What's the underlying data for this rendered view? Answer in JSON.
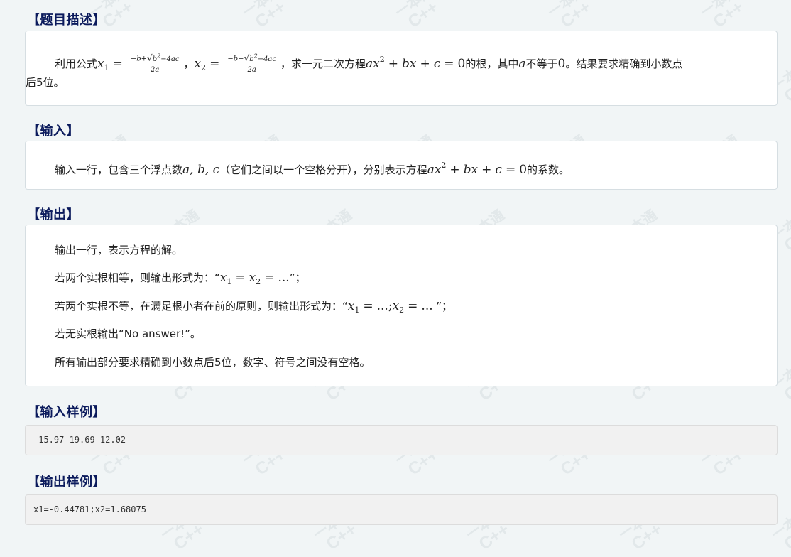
{
  "watermark": {
    "text": "C++",
    "glyph": "一本通",
    "color": "#e2e8ea"
  },
  "sections": {
    "description": {
      "heading": "【题目描述】",
      "p1": {
        "t1": "利用公式",
        "x1": "x",
        "s1": "1",
        "eq1": "=",
        "frac1_num_a": "−b+",
        "frac1_num_root": "b",
        "frac1_num_sq": "2",
        "frac1_num_b": "−4ac",
        "frac1_den": "2a",
        "sep": "，",
        "x2": "x",
        "s2": "2",
        "eq2": "=",
        "frac2_num_a": "−b−",
        "frac2_num_root": "b",
        "frac2_num_sq": "2",
        "frac2_num_b": "−4ac",
        "frac2_den": "2a",
        "t2": "，求一元二次方程",
        "eq_a": "ax",
        "eq_sq": "2",
        "eq_plus1": "+",
        "eq_b": "bx",
        "eq_plus2": "+",
        "eq_c": "c",
        "eq_eq": "=",
        "eq_zero": "0",
        "t3": "的根，其中",
        "var_a": "a",
        "t4": "不等于",
        "zero": "0",
        "t5": "。结果要求精确到小数点",
        "t6": "后5位。"
      }
    },
    "input": {
      "heading": "【输入】",
      "p1": {
        "t1": "输入一行，包含三个浮点数",
        "vars": "a, b, c",
        "t2": "（它们之间以一个空格分开），分别表示方程",
        "eq_a": "ax",
        "eq_sq": "2",
        "eq_plus1": "+",
        "eq_b": "bx",
        "eq_plus2": "+",
        "eq_c": "c",
        "eq_eq": "=",
        "eq_zero": "0",
        "t3": "的系数。"
      }
    },
    "output": {
      "heading": "【输出】",
      "p1": "输出一行，表示方程的解。",
      "p2": {
        "t1": "若两个实根相等，则输出形式为：“",
        "x1": "x",
        "s1": "1",
        "eq1": "=",
        "x2": "x",
        "s2": "2",
        "eq2": "=",
        "dots": "...",
        "t2": "”；"
      },
      "p3": {
        "t1": "若两个实根不等，在满足根小者在前的原则，则输出形式为：“",
        "x1": "x",
        "s1": "1",
        "eq1": "=",
        "dots1": "...;",
        "x2": "x",
        "s2": "2",
        "eq2": "=",
        "dots2": "...",
        "t2": " ”；"
      },
      "p4": "若无实根输出“No answer!”。",
      "p5": "所有输出部分要求精确到小数点后5位，数字、符号之间没有空格。"
    },
    "sample_input": {
      "heading": "【输入样例】",
      "code": "-15.97 19.69 12.02"
    },
    "sample_output": {
      "heading": "【输出样例】",
      "code": "x1=-0.44781;x2=1.68075"
    }
  }
}
